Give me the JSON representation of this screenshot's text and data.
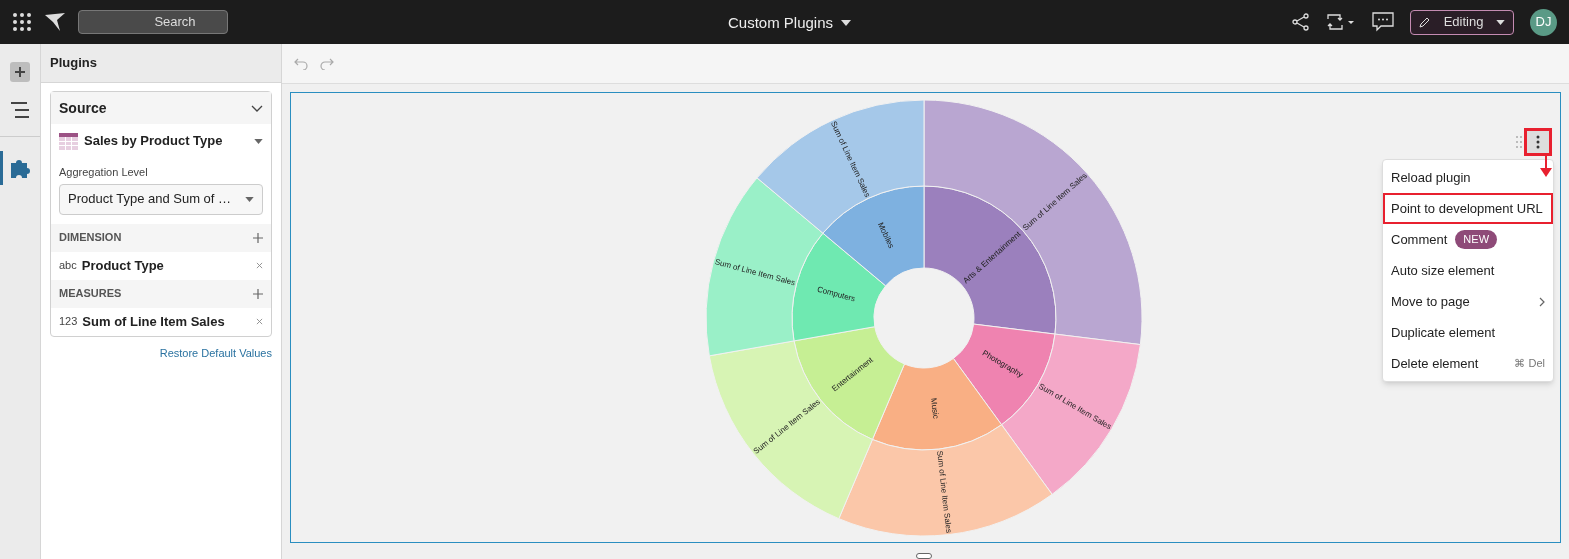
{
  "topbar": {
    "search_placeholder": "Search",
    "title": "Custom Plugins",
    "mode": "Editing",
    "avatar": "DJ"
  },
  "rail": {
    "items": [
      {
        "kind": "add",
        "selected": false
      },
      {
        "kind": "layers",
        "selected": false
      },
      {
        "kind": "plugin",
        "selected": true
      }
    ]
  },
  "panel": {
    "title": "Plugins",
    "source": {
      "heading": "Source",
      "dataset": "Sales by Product Type",
      "aggregation_label": "Aggregation Level",
      "aggregation_value": "Product Type and Sum of …"
    },
    "sections": [
      {
        "heading": "DIMENSION",
        "fields": [
          {
            "type_tag": "abc",
            "name": "Product Type"
          }
        ]
      },
      {
        "heading": "MEASURES",
        "fields": [
          {
            "type_tag": "123",
            "name": "Sum of Line Item Sales"
          }
        ]
      }
    ],
    "restore_link": "Restore Default Values"
  },
  "chart": {
    "segments": [
      {
        "label": "Arts & Entertainment",
        "color": "#9b80bd",
        "outer_label": "Sum of Line Item Sales"
      },
      {
        "label": "Photography",
        "color": "#ef83b0",
        "outer_label": "Sum of Line Item Sales"
      },
      {
        "label": "Music",
        "color": "#f9af84",
        "outer_label": "Sum of Line Item Sales"
      },
      {
        "label": "Entertainment",
        "color": "#c6ef94",
        "outer_label": "Sum of Line Item Sales"
      },
      {
        "label": "Computers",
        "color": "#6fe9b1",
        "outer_label": "Sum of Line Item Sales"
      },
      {
        "label": "Mobiles",
        "color": "#7eb1e0",
        "outer_label": "Sum of Line Item Sales"
      }
    ]
  },
  "menu": {
    "kebab_highlighted": true,
    "items": [
      {
        "kind": "plain",
        "label": "Reload plugin",
        "highlighted": false
      },
      {
        "kind": "plain",
        "label": "Point to development URL",
        "highlighted": true
      },
      {
        "kind": "badge",
        "label": "Comment",
        "badge": "NEW",
        "highlighted": false
      },
      {
        "kind": "plain",
        "label": "Auto size element",
        "highlighted": false
      },
      {
        "kind": "submenu",
        "label": "Move to page",
        "highlighted": false
      },
      {
        "kind": "plain",
        "label": "Duplicate element",
        "highlighted": false
      },
      {
        "kind": "shortcut",
        "label": "Delete element",
        "shortcut": "⌘ Del",
        "highlighted": false
      }
    ]
  }
}
